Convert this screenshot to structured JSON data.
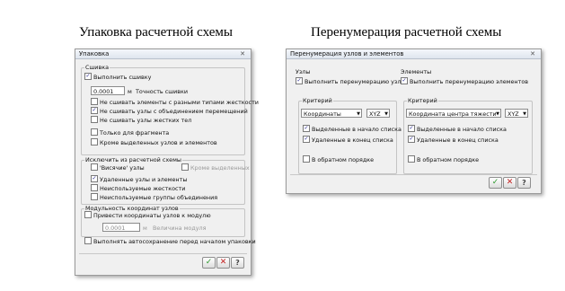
{
  "captions": {
    "left": "Упаковка расчетной схемы",
    "right": "Перенумерация расчетной схемы"
  },
  "pack": {
    "title": "Упаковка",
    "close_icon": "close-x-icon",
    "sewing": {
      "group_label": "Сшивка",
      "do_sewing": "Выполнить сшивку",
      "precision_value": "0.0001",
      "precision_unit": "м",
      "precision_label": "Точность сшивки",
      "opt_diff_stiffness": "Не сшивать элементы с разными типами жесткости",
      "opt_merged_nodes": "Не сшивать узлы с объединением перемещений",
      "opt_rigid_insert": "Не сшивать узлы жестких тел",
      "only_fragment": "Только для фрагмента",
      "except_selected": "Кроме выделенных узлов и элементов"
    },
    "exclude": {
      "group_label": "Исключить из расчетной схемы",
      "hanging_nodes": "'Висячие' узлы",
      "except_selected": "Кроме выделенных",
      "deleted": "Удаленные узлы и элементы",
      "unused_stiffness": "Неиспользуемые жесткости",
      "unused_groups": "Неиспользуемые группы объединения"
    },
    "modulus": {
      "group_label": "Модульность координат узлов",
      "bring_coords": "Привести координаты узлов к модулю",
      "value": "0.0001",
      "unit": "м",
      "value_label": "Величина модуля"
    },
    "autosave": "Выполнять автосохранение перед началом упаковки",
    "buttons": {
      "ok": "✓",
      "cancel": "✕",
      "help": "?"
    }
  },
  "renum": {
    "title": "Перенумерация узлов и элементов",
    "close_icon": "close-x-icon",
    "nodes": {
      "group_label": "Узлы",
      "do_renum": "Выполнить перенумерацию узлов",
      "criterion_label": "Критерий",
      "criterion_value": "Координаты",
      "axis_value": "XYZ",
      "selected_first": "Выделенные в начало списка",
      "deleted_last": "Удаленные в конец списка",
      "reverse": "В обратном порядке"
    },
    "elements": {
      "group_label": "Элементы",
      "do_renum": "Выполнить перенумерацию элементов",
      "criterion_label": "Критерий",
      "criterion_value": "Координата центра тяжести",
      "axis_value": "XYZ",
      "selected_first": "Выделенные в начало списка",
      "deleted_last": "Удаленные в конец списка",
      "reverse": "В обратном порядке"
    },
    "buttons": {
      "ok": "✓",
      "cancel": "✕",
      "help": "?"
    }
  }
}
